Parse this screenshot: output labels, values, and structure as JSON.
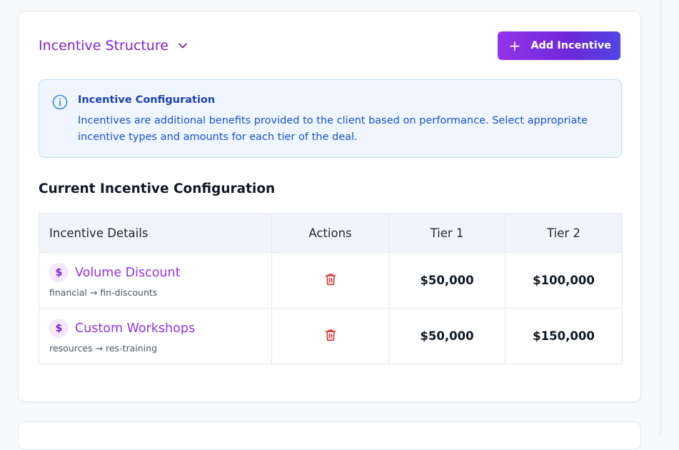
{
  "section": {
    "title": "Incentive Structure",
    "add_button_label": "Add Incentive"
  },
  "info": {
    "title": "Incentive Configuration",
    "text": "Incentives are additional benefits provided to the client based on performance. Select appropriate incentive types and amounts for each tier of the deal."
  },
  "table": {
    "heading": "Current Incentive Configuration",
    "columns": [
      "Incentive Details",
      "Actions",
      "Tier 1",
      "Tier 2"
    ],
    "rows": [
      {
        "icon": "dollar-icon",
        "name": "Volume Discount",
        "path": "financial → fin-discounts",
        "tier1": "$50,000",
        "tier2": "$100,000"
      },
      {
        "icon": "dollar-icon",
        "name": "Custom Workshops",
        "path": "resources → res-training",
        "tier1": "$50,000",
        "tier2": "$150,000"
      }
    ]
  },
  "colors": {
    "accent": "#7e22ce",
    "button_gradient_start": "#9333ea",
    "button_gradient_end": "#4f46e5",
    "info_bg": "#eff6ff",
    "info_text": "#1d4ed8",
    "delete": "#dc2626"
  }
}
